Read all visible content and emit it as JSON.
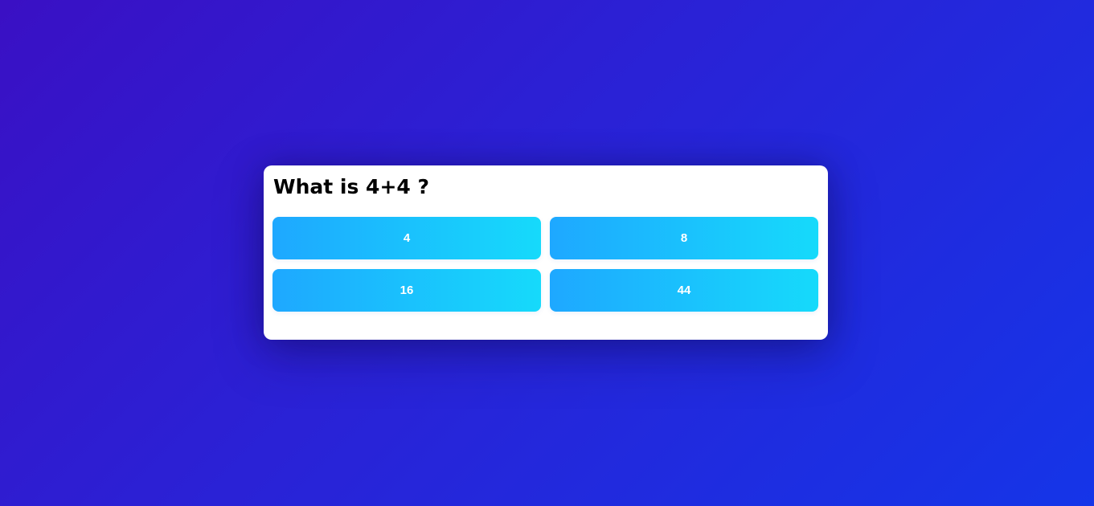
{
  "quiz": {
    "question": "What is 4+4 ?",
    "answers": [
      {
        "label": "4"
      },
      {
        "label": "8"
      },
      {
        "label": "16"
      },
      {
        "label": "44"
      }
    ]
  },
  "colors": {
    "background_start": "#3a10c4",
    "background_end": "#1535e8",
    "card": "#ffffff",
    "button_start": "#1ea8ff",
    "button_end": "#16dafb",
    "button_text": "#ffffff",
    "question_text": "#000000"
  }
}
